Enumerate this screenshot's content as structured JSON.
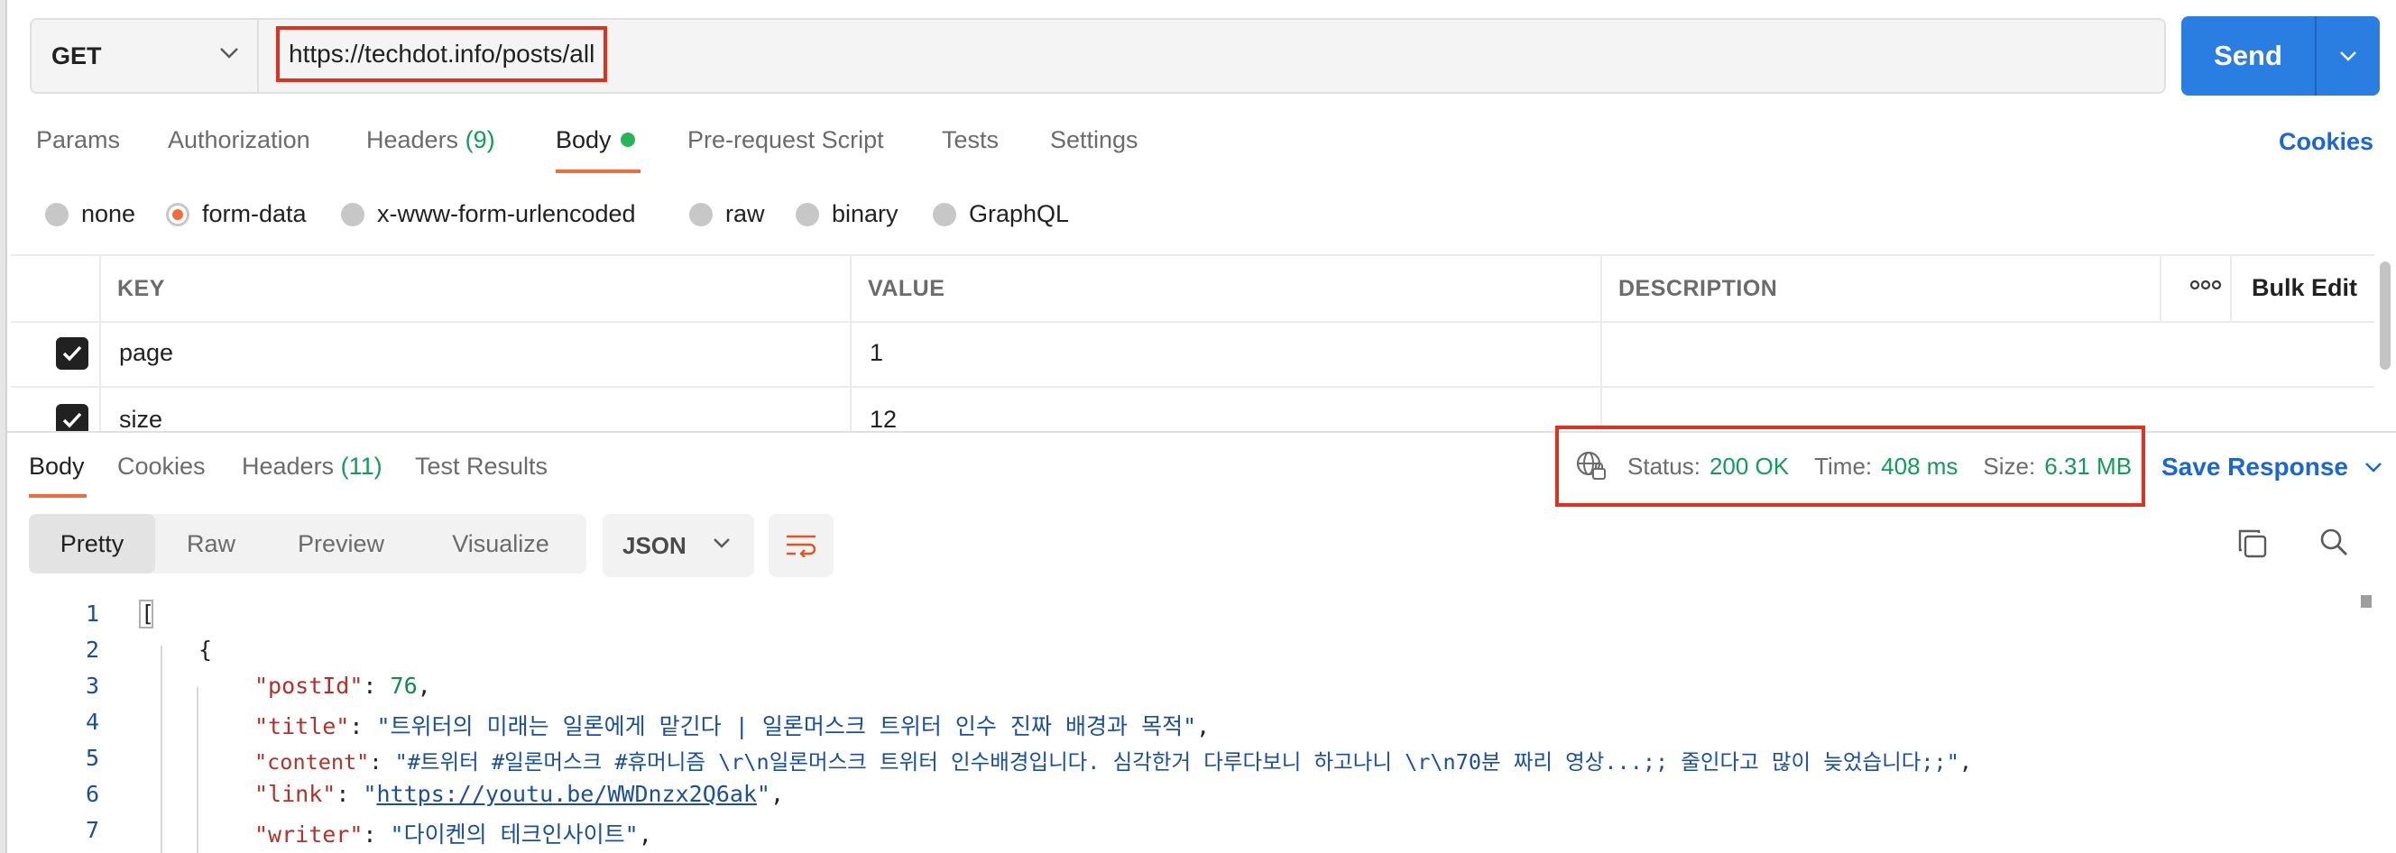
{
  "request": {
    "method": "GET",
    "url": "https://techdot.info/posts/all",
    "send_label": "Send"
  },
  "request_tabs": [
    {
      "label": "Params"
    },
    {
      "label": "Authorization"
    },
    {
      "label": "Headers",
      "count": "(9)"
    },
    {
      "label": "Body"
    },
    {
      "label": "Pre-request Script"
    },
    {
      "label": "Tests"
    },
    {
      "label": "Settings"
    }
  ],
  "cookies_label": "Cookies",
  "body_types": [
    "none",
    "form-data",
    "x-www-form-urlencoded",
    "raw",
    "binary",
    "GraphQL"
  ],
  "body_type_selected": "form-data",
  "params_table": {
    "headers": [
      "KEY",
      "VALUE",
      "DESCRIPTION"
    ],
    "bulk_edit_label": "Bulk Edit",
    "rows": [
      {
        "checked": true,
        "key": "page",
        "value": "1",
        "description": ""
      },
      {
        "checked": true,
        "key": "size",
        "value": "12",
        "description": ""
      }
    ]
  },
  "response_tabs": [
    {
      "label": "Body"
    },
    {
      "label": "Cookies"
    },
    {
      "label": "Headers",
      "count": "(11)"
    },
    {
      "label": "Test Results"
    }
  ],
  "response_meta": {
    "status_label": "Status:",
    "status_value": "200 OK",
    "time_label": "Time:",
    "time_value": "408 ms",
    "size_label": "Size:",
    "size_value": "6.31 MB",
    "save_label": "Save Response"
  },
  "view_modes": [
    "Pretty",
    "Raw",
    "Preview",
    "Visualize"
  ],
  "view_mode_selected": "Pretty",
  "format": "JSON",
  "code_lines": [
    {
      "n": "1",
      "text": "["
    },
    {
      "n": "2",
      "text": "{"
    },
    {
      "n": "3",
      "key": "\"postId\"",
      "value": "76",
      "kind": "num"
    },
    {
      "n": "4",
      "key": "\"title\"",
      "value": "\"트위터의 미래는 일론에게 맡긴다 | 일론머스크 트위터 인수 진짜 배경과 목적\"",
      "kind": "str"
    },
    {
      "n": "5",
      "key": "\"content\"",
      "value": "\"#트위터 #일론머스크 #휴머니즘 \\r\\n일론머스크 트위터 인수배경입니다. 심각한거 다루다보니 하고나니 \\r\\n70분 짜리 영상...;; 줄인다고 많이 늦었습니다;;\"",
      "kind": "str"
    },
    {
      "n": "6",
      "key": "\"link\"",
      "value": "https://youtu.be/WWDnzx2Q6ak",
      "kind": "link"
    },
    {
      "n": "7",
      "key": "\"writer\"",
      "value": "\"다이켄의 테크인사이트\"",
      "kind": "str"
    }
  ],
  "colors": {
    "accent": "#2a7de1",
    "tab_underline": "#f26b3a",
    "success": "#0f9d58",
    "highlight_box": "#e0301e"
  }
}
